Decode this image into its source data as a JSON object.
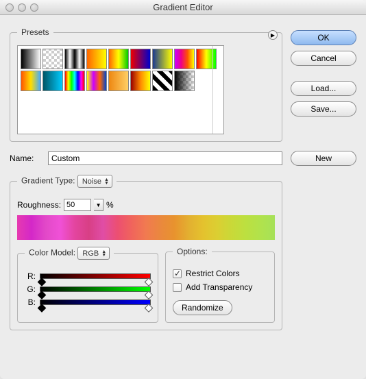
{
  "title": "Gradient Editor",
  "buttons": {
    "ok": "OK",
    "cancel": "Cancel",
    "load": "Load...",
    "save": "Save...",
    "new": "New",
    "randomize": "Randomize"
  },
  "presets": {
    "legend": "Presets",
    "swatches": [
      {
        "bg": "linear-gradient(90deg,#000,#fff)"
      },
      {
        "bg": "repeating-conic-gradient(#ccc 0 25%, #fff 0 50%) 0/8px 8px"
      },
      {
        "bg": "linear-gradient(90deg,#000,#fff,#000,#fff,#000)"
      },
      {
        "bg": "linear-gradient(90deg,#f60,#ff0)"
      },
      {
        "bg": "linear-gradient(90deg,#f60,#ff0,#0c0)"
      },
      {
        "bg": "linear-gradient(90deg,#e00,#00c)"
      },
      {
        "bg": "linear-gradient(90deg,#1b3a8f,#ff0)"
      },
      {
        "bg": "linear-gradient(90deg,#c0f,#e08,#f50,#ff0)"
      },
      {
        "bg": "linear-gradient(90deg,#f00,#ff0,#0f0)"
      },
      {
        "bg": "linear-gradient(90deg,#f50,#fd0,#4af)"
      },
      {
        "bg": "linear-gradient(90deg,#056,#0cf)"
      },
      {
        "bg": "linear-gradient(90deg,#f00,#ff0,#0f0,#0ff,#00f,#f0f,#f00)"
      },
      {
        "bg": "linear-gradient(90deg,#ff0,#c0f,#f60,#04c)"
      },
      {
        "bg": "linear-gradient(90deg,#e81,#ffcf66)"
      },
      {
        "bg": "linear-gradient(90deg,#900,#f80,#ff0)"
      },
      {
        "bg": "repeating-linear-gradient(45deg,#000 0 6px,#fff 6px 12px)"
      },
      {
        "bg": "linear-gradient(90deg,#000,transparent), repeating-conic-gradient(#ccc 0 25%, #fff 0 50%) 0/8px 8px"
      }
    ]
  },
  "name": {
    "label": "Name:",
    "value": "Custom"
  },
  "gradientType": {
    "legend": "Gradient Type:",
    "value": "Noise",
    "roughness_label": "Roughness:",
    "roughness_value": "50",
    "roughness_suffix": "%"
  },
  "colorModel": {
    "legend": "Color Model:",
    "value": "RGB",
    "channels": [
      {
        "label": "R:",
        "grad": "linear-gradient(90deg,#000,#f00)"
      },
      {
        "label": "G:",
        "grad": "linear-gradient(90deg,#000,#0f0)"
      },
      {
        "label": "B:",
        "grad": "linear-gradient(90deg,#000,#00f)"
      }
    ]
  },
  "options": {
    "legend": "Options:",
    "restrict_label": "Restrict Colors",
    "restrict_checked": true,
    "transparency_label": "Add Transparency",
    "transparency_checked": false
  }
}
